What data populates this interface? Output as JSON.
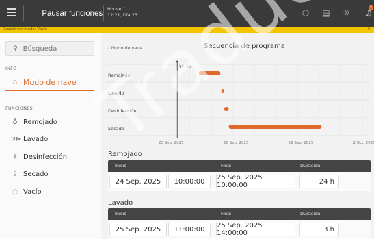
{
  "header": {
    "pause_label": "Pausar funciones",
    "house_line1": "House 1",
    "house_line2": "12:21, Día 23",
    "notification_count": "2",
    "icons": [
      "menu-icon",
      "pause-icon",
      "cube-icon",
      "document-icon",
      "signal-icon",
      "bell-icon"
    ]
  },
  "banner": {
    "text": "Desactivar modo: Vacío",
    "close": "×"
  },
  "sidebar": {
    "search_placeholder": "Búsqueda",
    "info_label": "INFO",
    "functions_label": "FUNCIONES",
    "info_items": [
      {
        "label": "Modo de nave",
        "icon": "barn-icon",
        "active": true
      }
    ],
    "function_items": [
      {
        "label": "Remojado",
        "icon": "drop-icon"
      },
      {
        "label": "Lavado",
        "icon": "spray-icon"
      },
      {
        "label": "Desinfección",
        "icon": "flask-icon"
      },
      {
        "label": "Secado",
        "icon": "heat-icon"
      },
      {
        "label": "Vacío",
        "icon": "empty-icon"
      }
    ]
  },
  "main": {
    "back_label": "‹  Modo de nave",
    "title": "Secuencia de programa"
  },
  "chart_data": {
    "type": "gantt",
    "rows": [
      "Remojado",
      "Lavado",
      "Desinfección",
      "Secado"
    ],
    "x_ticks": [
      "23 Sep. 2025",
      "26 Sep. 2025",
      "29 Sep. 2025",
      "2 Oct. 2025"
    ],
    "now_label": "12:21",
    "now_day": 23.42,
    "xlim": [
      23.0,
      32.3
    ],
    "accent": "#e06a2b",
    "bars": [
      {
        "row": "Remojado",
        "start": 24.42,
        "end": 25.42
      },
      {
        "row": "Lavado",
        "start": 25.46,
        "end": 25.58
      },
      {
        "row": "Desinfección",
        "start": 25.58,
        "end": 25.8
      },
      {
        "row": "Secado",
        "start": 25.8,
        "end": 30.1
      }
    ]
  },
  "sections": [
    {
      "title": "Remojado",
      "headers": {
        "start": "Inicio",
        "end": "Final",
        "duration": "Duración"
      },
      "start_date": "24 Sep. 2025",
      "start_time": "10:00:00",
      "end": "25 Sep. 2025 10:00:00",
      "duration": "24 h"
    },
    {
      "title": "Lavado",
      "headers": {
        "start": "Inicio",
        "end": "Final",
        "duration": "Duración"
      },
      "start_date": "25 Sep. 2025",
      "start_time": "11:00:00",
      "end": "25 Sep. 2025 14:00:00",
      "duration": "3 h"
    }
  ],
  "watermark": "Traducción"
}
